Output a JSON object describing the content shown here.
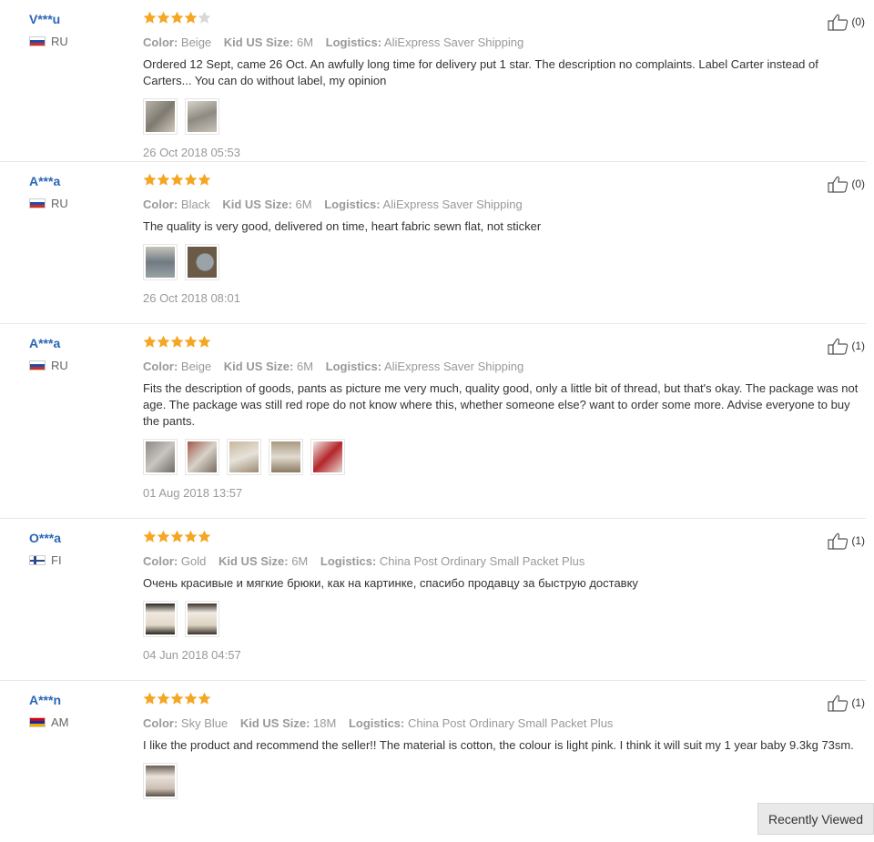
{
  "labels": {
    "color": "Color:",
    "size": "Kid US Size:",
    "logistics": "Logistics:"
  },
  "reviews": [
    {
      "user": "V***u",
      "country": "RU",
      "rating": 4,
      "color": "Beige",
      "size": "6M",
      "logistics": "AliExpress Saver Shipping",
      "text": "Ordered 12 Sept, came 26 Oct. An awfully long time for delivery put 1 star. The description no complaints. Label Carter instead of Carters... You can do without label, my opinion",
      "photos": 2,
      "date": "26 Oct 2018 05:53",
      "helpful": "(0)"
    },
    {
      "user": "A***a",
      "country": "RU",
      "rating": 5,
      "color": "Black",
      "size": "6M",
      "logistics": "AliExpress Saver Shipping",
      "text": "The quality is very good, delivered on time, heart fabric sewn flat, not sticker",
      "photos": 2,
      "date": "26 Oct 2018 08:01",
      "helpful": "(0)"
    },
    {
      "user": "A***a",
      "country": "RU",
      "rating": 5,
      "color": "Beige",
      "size": "6M",
      "logistics": "AliExpress Saver Shipping",
      "text": "Fits the description of goods, pants as picture me very much, quality good, only a little bit of thread, but that's okay. The package was not age. The package was still red rope do not know where this, whether someone else? want to order some more. Advise everyone to buy the pants.",
      "photos": 5,
      "date": "01 Aug 2018 13:57",
      "helpful": "(1)"
    },
    {
      "user": "O***a",
      "country": "FI",
      "rating": 5,
      "color": "Gold",
      "size": "6M",
      "logistics": "China Post Ordinary Small Packet Plus",
      "text": "Очень красивые и мягкие брюки, как на картинке, спасибо продавцу за быструю доставку",
      "photos": 2,
      "date": "04 Jun 2018 04:57",
      "helpful": "(1)"
    },
    {
      "user": "A***n",
      "country": "AM",
      "rating": 5,
      "color": "Sky Blue",
      "size": "18M",
      "logistics": "China Post Ordinary Small Packet Plus",
      "text": "I like the product and recommend the seller!! The material is cotton, the colour is light pink. I think it will suit my 1 year baby 9.3kg 73sm.",
      "photos": 1,
      "date": "",
      "helpful": "(1)"
    }
  ],
  "recently_viewed": "Recently Viewed",
  "colors": {
    "username": "#2a66b6",
    "star_filled": "#f5a623",
    "star_empty": "#d8d8d8"
  },
  "icons": {
    "helpful": "thumbs-up-icon",
    "star": "star-icon"
  }
}
